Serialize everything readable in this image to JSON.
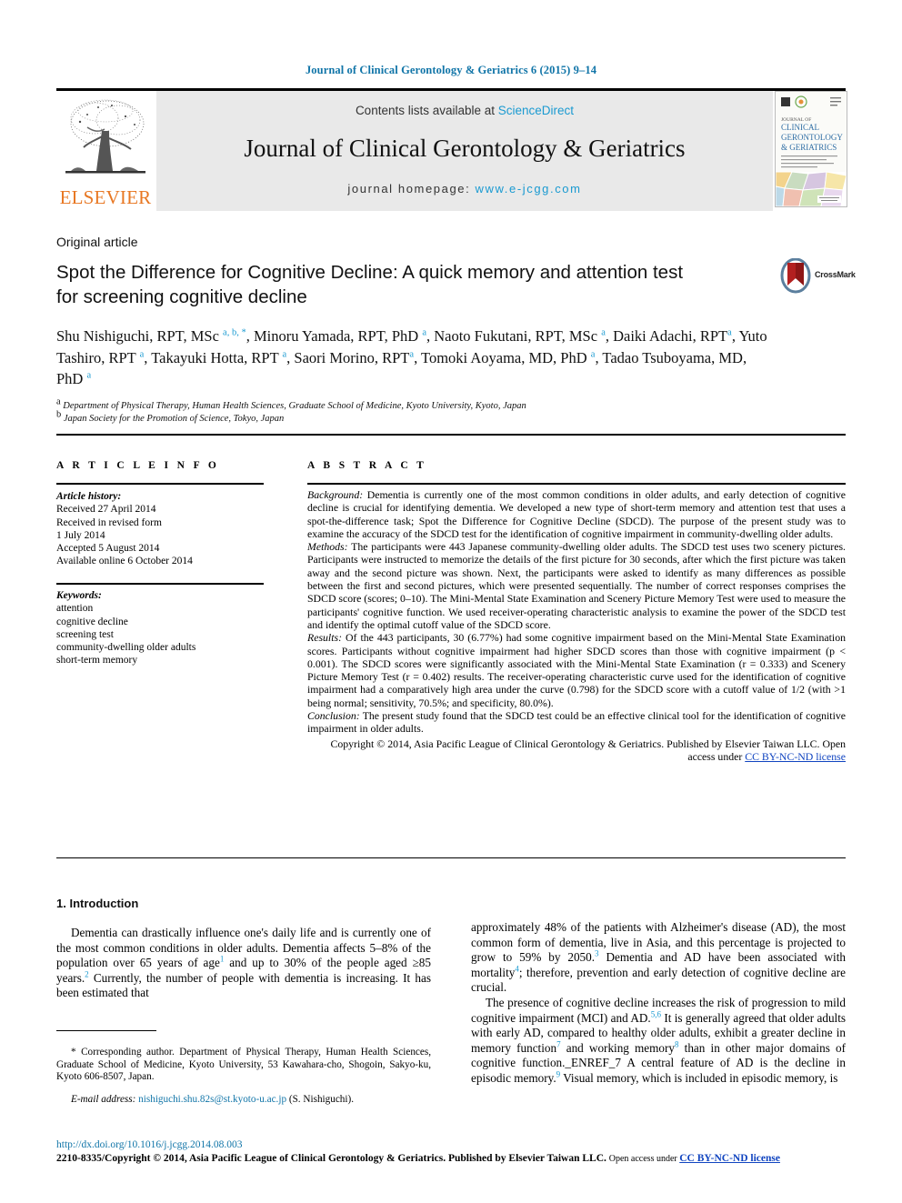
{
  "running_head": "Journal of Clinical Gerontology & Geriatrics 6 (2015) 9–14",
  "masthead": {
    "publisher_name": "ELSEVIER",
    "publisher_logo_alt": "elsevier-tree-logo",
    "contents_prefix": "Contents lists available at ",
    "contents_link": "ScienceDirect",
    "journal_title": "Journal of Clinical Gerontology & Geriatrics",
    "homepage_label": "journal homepage: ",
    "homepage_url": "www.e-jcgg.com",
    "cover_lines": [
      "JOURNAL OF",
      "CLINICAL",
      "GERONTOLOGY",
      "& GERIATRICS"
    ]
  },
  "article": {
    "type": "Original article",
    "title": "Spot the Difference for Cognitive Decline: A quick memory and attention test for screening cognitive decline",
    "crossmark_label": "CrossMark",
    "authors_html": "Shu Nishiguchi, RPT, MSc <sup>a, b, *</sup>, Minoru Yamada, RPT, PhD <sup>a</sup>, Naoto Fukutani, RPT, MSc <sup>a</sup>, Daiki Adachi, RPT<sup>a</sup>, Yuto Tashiro, RPT <sup>a</sup>, Takayuki Hotta, RPT <sup>a</sup>, Saori Morino, RPT<sup>a</sup>, Tomoki Aoyama, MD, PhD <sup>a</sup>, Tadao Tsuboyama, MD, PhD <sup>a</sup>",
    "affiliations": [
      {
        "mark": "a",
        "text": "Department of Physical Therapy, Human Health Sciences, Graduate School of Medicine, Kyoto University, Kyoto, Japan"
      },
      {
        "mark": "b",
        "text": "Japan Society for the Promotion of Science, Tokyo, Japan"
      }
    ]
  },
  "info": {
    "heading": "A R T I C L E   I N F O",
    "history_label": "Article history:",
    "history": [
      "Received 27 April 2014",
      "Received in revised form",
      "1 July 2014",
      "Accepted 5 August 2014",
      "Available online 6 October 2014"
    ],
    "keywords_label": "Keywords:",
    "keywords": [
      "attention",
      "cognitive decline",
      "screening test",
      "community-dwelling older adults",
      "short-term memory"
    ]
  },
  "abstract": {
    "heading": "A B S T R A C T",
    "background_label": "Background:",
    "background": " Dementia is currently one of the most common conditions in older adults, and early detection of cognitive decline is crucial for identifying dementia. We developed a new type of short-term memory and attention test that uses a spot-the-difference task; Spot the Difference for Cognitive Decline (SDCD). The purpose of the present study was to examine the accuracy of the SDCD test for the identification of cognitive impairment in community-dwelling older adults.",
    "methods_label": "Methods:",
    "methods": " The participants were 443 Japanese community-dwelling older adults. The SDCD test uses two scenery pictures. Participants were instructed to memorize the details of the first picture for 30 seconds, after which the first picture was taken away and the second picture was shown. Next, the participants were asked to identify as many differences as possible between the first and second pictures, which were presented sequentially. The number of correct responses comprises the SDCD score (scores; 0–10). The Mini-Mental State Examination and Scenery Picture Memory Test were used to measure the participants' cognitive function. We used receiver-operating characteristic analysis to examine the power of the SDCD test and identify the optimal cutoff value of the SDCD score.",
    "results_label": "Results:",
    "results": " Of the 443 participants, 30 (6.77%) had some cognitive impairment based on the Mini-Mental State Examination scores. Participants without cognitive impairment had higher SDCD scores than those with cognitive impairment (p < 0.001). The SDCD scores were significantly associated with the Mini-Mental State Examination (r = 0.333) and Scenery Picture Memory Test (r = 0.402) results. The receiver-operating characteristic curve used for the identification of cognitive impairment had a comparatively high area under the curve (0.798) for the SDCD score with a cutoff value of 1/2 (with >1 being normal; sensitivity, 70.5%; and specificity, 80.0%).",
    "conclusion_label": "Conclusion:",
    "conclusion": " The present study found that the SDCD test could be an effective clinical tool for the identification of cognitive impairment in older adults.",
    "copyright_text": "Copyright © 2014, Asia Pacific League of Clinical Gerontology & Geriatrics. Published by Elsevier Taiwan LLC. Open access under ",
    "copyright_link": "CC BY-NC-ND license"
  },
  "body": {
    "intro_heading": "1. Introduction",
    "left_paragraph_html": "Dementia can drastically influence one's daily life and is currently one of the most common conditions in older adults. Dementia affects 5&#8211;8% of the population over 65 years of age<sup class=\"ref\">1</sup> and up to 30% of the people aged &#8805;85 years.<sup class=\"ref\">2</sup> Currently, the number of people with dementia is increasing. It has been estimated that",
    "right_paragraph1_html": "approximately 48% of the patients with Alzheimer's disease (AD), the most common form of dementia, live in Asia, and this percentage is projected to grow to 59% by 2050.<sup class=\"ref\">3</sup> Dementia and AD have been associated with mortality<sup class=\"ref\">4</sup>; therefore, prevention and early detection of cognitive decline are crucial.",
    "right_paragraph2_html": "The presence of cognitive decline increases the risk of progression to mild cognitive impairment (MCI) and AD.<sup class=\"ref\">5,6</sup> It is generally agreed that older adults with early AD, compared to healthy older adults, exhibit a greater decline in memory function<sup class=\"ref\">7</sup> and working memory<sup class=\"ref\">8</sup> than in other major domains of cognitive function._ENREF_7 A central feature of AD is the decline in episodic memory.<sup class=\"ref\">9</sup> Visual memory, which is included in episodic memory, is"
  },
  "footnote": {
    "corresponding_html": "* Corresponding author. Department of Physical Therapy, Human Health Sciences, Graduate School of Medicine, Kyoto University, 53 Kawahara-cho, Shogoin, Sakyo-ku, Kyoto 606-8507, Japan.",
    "email_label": "E-mail address:",
    "email": "nishiguchi.shu.82s@st.kyoto-u.ac.jp",
    "email_suffix": "(S. Nishiguchi)."
  },
  "footer": {
    "doi": "http://dx.doi.org/10.1016/j.jcgg.2014.08.003",
    "issn_copyright": "2210-8335/Copyright © 2014, Asia Pacific League of Clinical Gerontology & Geriatrics.",
    "published_by": " Published by Elsevier Taiwan LLC. ",
    "open_access": "Open access under ",
    "license_link": "CC BY-NC-ND license"
  },
  "colors": {
    "link_teal": "#1175a8",
    "link_blue": "#1044c0",
    "sciencedirect": "#1a9ad1",
    "elsevier_orange": "#e87722",
    "masthead_bg": "#e9e9e9"
  }
}
